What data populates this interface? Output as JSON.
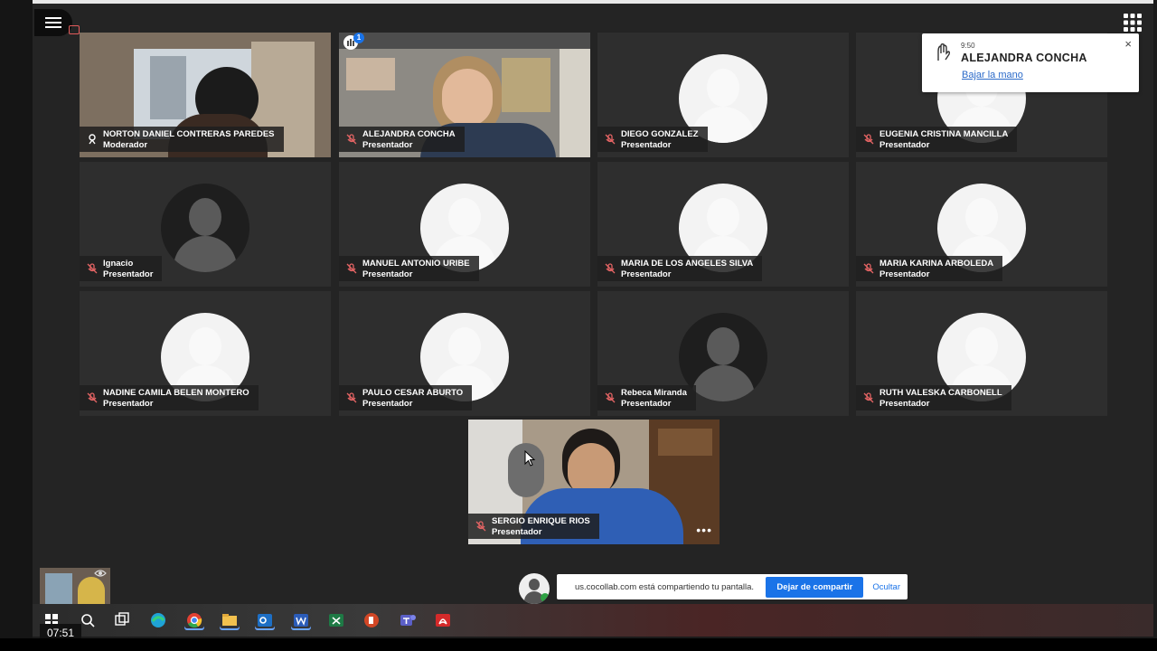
{
  "notification": {
    "time": "9:50",
    "name": "ALEJANDRA CONCHA",
    "action": "Bajar la mano",
    "close": "×"
  },
  "raised_hands_badge": "1",
  "participants": [
    {
      "name": "NORTON DANIEL CONTRERAS PAREDES",
      "role": "Moderador"
    },
    {
      "name": "ALEJANDRA CONCHA",
      "role": "Presentador"
    },
    {
      "name": "DIEGO GONZALEZ",
      "role": "Presentador"
    },
    {
      "name": "EUGENIA CRISTINA MANCILLA",
      "role": "Presentador"
    },
    {
      "name": "Ignacio",
      "role": "Presentador"
    },
    {
      "name": "MANUEL ANTONIO URIBE",
      "role": "Presentador"
    },
    {
      "name": "MARIA DE LOS ANGELES SILVA",
      "role": "Presentador"
    },
    {
      "name": "MARIA KARINA ARBOLEDA",
      "role": "Presentador"
    },
    {
      "name": "NADINE CAMILA BELEN MONTERO",
      "role": "Presentador"
    },
    {
      "name": "PAULO CESAR ABURTO",
      "role": "Presentador"
    },
    {
      "name": "Rebeca Miranda",
      "role": "Presentador"
    },
    {
      "name": "RUTH VALESKA CARBONELL",
      "role": "Presentador"
    },
    {
      "name": "SERGIO ENRIQUE RIOS",
      "role": "Presentador"
    }
  ],
  "share_bar": {
    "message": "us.cocollab.com está compartiendo tu pantalla.",
    "stop_label": "Dejar de compartir",
    "hide_label": "Ocultar"
  },
  "more_label": "•••",
  "taskbar": {
    "clock": "07:51",
    "apps": [
      "start-icon",
      "search-icon",
      "task-view-icon",
      "edge-icon",
      "chrome-icon",
      "file-explorer-icon",
      "outlook-icon",
      "word-icon",
      "excel-icon",
      "powerpoint-icon",
      "teams-icon",
      "acrobat-icon"
    ]
  },
  "colors": {
    "active_border": "#d28a84",
    "share_button": "#1a73e8",
    "link": "#2b6ac9"
  }
}
